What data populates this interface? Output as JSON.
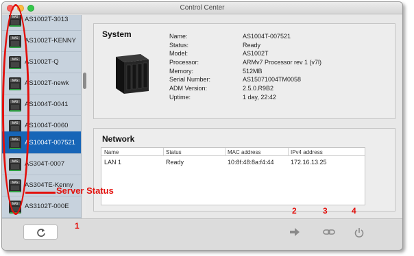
{
  "window": {
    "title": "Control Center"
  },
  "sidebar": {
    "items": [
      {
        "label": "AS1002T-3013",
        "active": false
      },
      {
        "label": "AS1002T-KENNY",
        "active": false
      },
      {
        "label": "AS1002T-Q",
        "active": false
      },
      {
        "label": "AS1002T-newk",
        "active": false
      },
      {
        "label": "AS1004T-0041",
        "active": false
      },
      {
        "label": "AS1004T-0060",
        "active": false
      },
      {
        "label": "AS1004T-007521",
        "active": true
      },
      {
        "label": "AS304T-0007",
        "active": false
      },
      {
        "label": "AS304TE-Kenny",
        "active": false
      },
      {
        "label": "AS3102T-000E",
        "active": false
      }
    ],
    "icon_text": "NAS"
  },
  "system": {
    "title": "System",
    "rows": [
      {
        "label": "Name:",
        "value": "AS1004T-007521"
      },
      {
        "label": "Status:",
        "value": "Ready"
      },
      {
        "label": "Model:",
        "value": "AS1002T"
      },
      {
        "label": "Processor:",
        "value": "ARMv7 Processor rev 1 (v7l)"
      },
      {
        "label": "Memory:",
        "value": "512MB"
      },
      {
        "label": "Serial Number:",
        "value": "AS15071004TM0058"
      },
      {
        "label": "ADM Version:",
        "value": "2.5.0.R9B2"
      },
      {
        "label": "Uptime:",
        "value": "1 day, 22:42"
      }
    ]
  },
  "network": {
    "title": "Network",
    "columns": [
      "Name",
      "Status",
      "MAC address",
      "IPv4 address"
    ],
    "rows": [
      {
        "name": "LAN 1",
        "status": "Ready",
        "mac": "10:8f:48:8a:f4:44",
        "ipv4": "172.16.13.25"
      }
    ]
  },
  "annotations": {
    "server_status_label": "Server Status",
    "numbers": [
      "1",
      "2",
      "3",
      "4"
    ],
    "color": "#e3100c"
  },
  "colors": {
    "selection": "#1765b7",
    "sidebar_bg": "#c7d2dd"
  }
}
